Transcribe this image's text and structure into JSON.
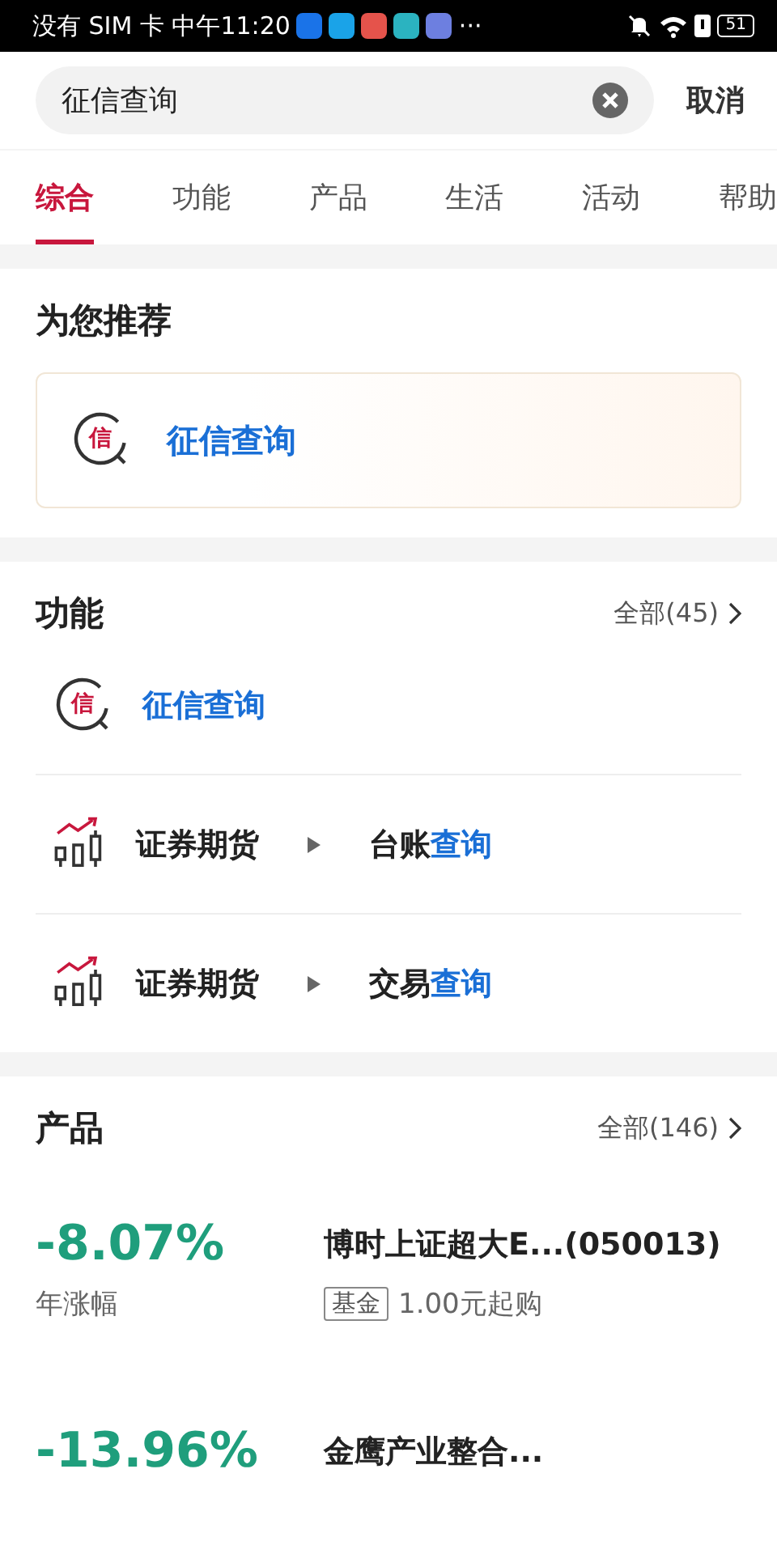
{
  "status_bar": {
    "carrier_time": "没有 SIM 卡 中午11:20",
    "more": "···",
    "battery": "51"
  },
  "search": {
    "value": "征信查询",
    "cancel": "取消"
  },
  "tabs": [
    {
      "label": "综合",
      "selected": true
    },
    {
      "label": "功能",
      "selected": false
    },
    {
      "label": "产品",
      "selected": false
    },
    {
      "label": "生活",
      "selected": false
    },
    {
      "label": "活动",
      "selected": false
    },
    {
      "label": "帮助",
      "selected": false
    }
  ],
  "recommend": {
    "title": "为您推荐",
    "item": {
      "badge": "信",
      "label": "征信查询"
    }
  },
  "functions": {
    "title": "功能",
    "all": "全部(45)",
    "items": [
      {
        "kind": "credit",
        "badge": "信",
        "match": "征信查询"
      },
      {
        "kind": "securities",
        "category": "证券期货",
        "prefix": "台账",
        "match": "查询"
      },
      {
        "kind": "securities",
        "category": "证券期货",
        "prefix": "交易",
        "match": "查询"
      }
    ]
  },
  "products": {
    "title": "产品",
    "all": "全部(146)",
    "items": [
      {
        "rate": "-8.07%",
        "rate_label": "年涨幅",
        "name": "博时上证超大E...(050013)",
        "tag": "基金",
        "min": "1.00元起购"
      },
      {
        "rate": "-13.96%",
        "name": "金鹰产业整合..."
      }
    ]
  }
}
